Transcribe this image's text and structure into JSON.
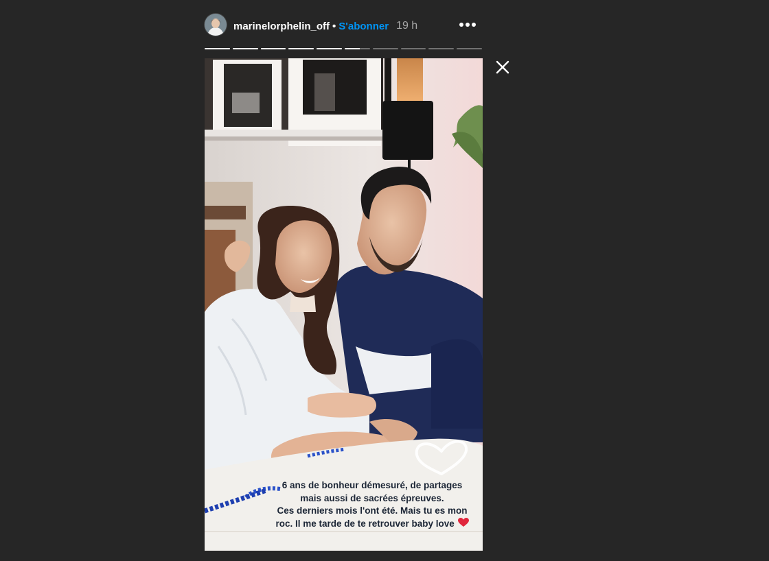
{
  "header": {
    "username": "marinelorphelin_off",
    "separator": "•",
    "follow_label": "S'abonner",
    "time": "19 h",
    "more_icon": "more-horizontal-icon"
  },
  "progress": {
    "total_segments": 10,
    "completed_segments": 5,
    "current_segment_fraction": 0.6
  },
  "story": {
    "caption_lines": [
      "6 ans de bonheur démesuré, de partages",
      "mais aussi de sacrées épreuves.",
      "Ces derniers mois l'ont été.  Mais tu es mon",
      "roc. Il me tarde de te retrouver baby love"
    ],
    "caption_emoji_icon": "red-heart-icon",
    "sticker_icon": "white-heart-outline-icon"
  },
  "controls": {
    "close_icon": "close-icon"
  },
  "colors": {
    "background": "#262626",
    "follow_accent": "#0095f6",
    "caption_text": "#1c2636",
    "heart_red": "#e0263c"
  }
}
